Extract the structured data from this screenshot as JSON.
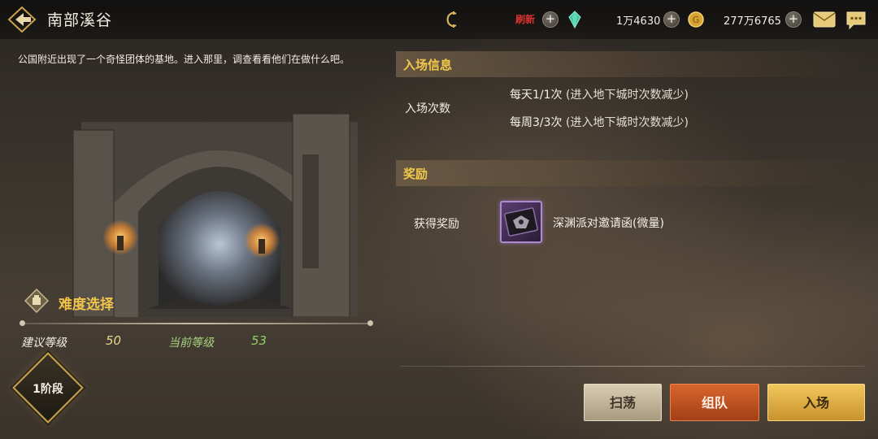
{
  "header": {
    "title": "南部溪谷",
    "refresh_label": "刷新",
    "currency_1": "1万4630",
    "currency_2": "277万6765"
  },
  "description": "公国附近出现了一个奇怪团体的基地。进入那里，调查看看他们在做什么吧。",
  "difficulty": {
    "title": "难度选择",
    "recommended_label": "建议等级",
    "recommended_value": "50",
    "current_label": "当前等级",
    "current_value": "53",
    "stage_label": "1阶段"
  },
  "entry_info": {
    "title": "入场信息",
    "count_label": "入场次数",
    "daily": "每天1/1次",
    "daily_note": "(进入地下城时次数减少)",
    "weekly": "每周3/3次",
    "weekly_note": "(进入地下城时次数减少)"
  },
  "rewards": {
    "title": "奖励",
    "label": "获得奖励",
    "item_name": "深渊派对邀请函(微量)"
  },
  "actions": {
    "sweep": "扫荡",
    "team": "组队",
    "enter": "入场"
  },
  "colors": {
    "accent_gold": "#f2c84c",
    "refresh_red": "#e0332e",
    "current_level_green": "#8fd06a",
    "recommended_level_yellow": "#e8d68a"
  },
  "icons": [
    "back-arrow-icon",
    "spinner-icon",
    "gem-icon",
    "coin-icon",
    "mail-icon",
    "chat-icon",
    "difficulty-emblem-icon",
    "invitation-item-icon"
  ]
}
